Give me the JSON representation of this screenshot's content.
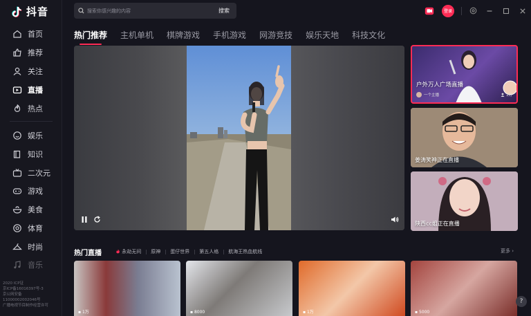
{
  "app": {
    "brand": "抖音",
    "accent": "#fe2c55"
  },
  "sidebar": {
    "items": [
      {
        "label": "首页",
        "icon": "home-icon"
      },
      {
        "label": "推荐",
        "icon": "thumb-icon"
      },
      {
        "label": "关注",
        "icon": "user-icon"
      },
      {
        "label": "直播",
        "icon": "live-icon",
        "active": true
      },
      {
        "label": "热点",
        "icon": "flame-icon"
      },
      {
        "label": "娱乐",
        "icon": "smile-icon"
      },
      {
        "label": "知识",
        "icon": "book-icon"
      },
      {
        "label": "二次元",
        "icon": "tv-icon"
      },
      {
        "label": "游戏",
        "icon": "gamepad-icon"
      },
      {
        "label": "美食",
        "icon": "food-icon"
      },
      {
        "label": "体育",
        "icon": "ball-icon"
      },
      {
        "label": "时尚",
        "icon": "hanger-icon"
      },
      {
        "label": "音乐",
        "icon": "music-icon"
      }
    ],
    "footer": [
      "2020 ICP证",
      "京ICP备16016397号-3",
      "京公网安备",
      "11000002002046号",
      "广播电视节目制作经营许可"
    ]
  },
  "search": {
    "placeholder": "搜索你感兴趣的内容",
    "button_label": "搜索"
  },
  "header": {
    "login_label": "登录"
  },
  "tabs": [
    {
      "label": "热门推荐",
      "active": true
    },
    {
      "label": "主机单机"
    },
    {
      "label": "棋牌游戏"
    },
    {
      "label": "手机游戏"
    },
    {
      "label": "网游竞技"
    },
    {
      "label": "娱乐天地"
    },
    {
      "label": "科技文化"
    }
  ],
  "recommendations": [
    {
      "caption": "户外万人广场直播",
      "author": "一个主播",
      "count": "1万",
      "selected": true
    },
    {
      "caption": "姜涛笑神正在直播"
    },
    {
      "caption": "陕西cc姐正在直播"
    }
  ],
  "hot_live": {
    "title": "热门直播",
    "categories": [
      "永劫无间",
      "原神",
      "蛋仔世界",
      "第五人格",
      "航海王热血航线"
    ],
    "more_label": "更多",
    "thumbs": [
      {
        "views": "1万"
      },
      {
        "views": "8000"
      },
      {
        "views": "1万"
      },
      {
        "views": "5000"
      }
    ]
  },
  "help_label": "?"
}
